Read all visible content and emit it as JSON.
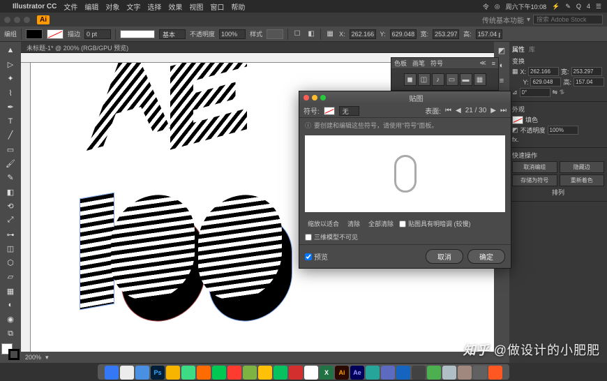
{
  "mac": {
    "apple": "",
    "app": "Illustrator CC",
    "menus": [
      "文件",
      "编辑",
      "对象",
      "文字",
      "选择",
      "效果",
      "视图",
      "窗口",
      "帮助"
    ],
    "right": [
      "令",
      "◎",
      "周六下午10:08",
      "⚡",
      "✎",
      "Q",
      "4",
      "☰"
    ]
  },
  "header": {
    "workspace_label": "传统基本功能",
    "search_placeholder": "搜索 Adobe Stock"
  },
  "options": {
    "stroke_label": "描边",
    "stroke_pt": "0 pt",
    "profile": "基本",
    "opacity_label": "不透明度",
    "opacity_val": "100%",
    "style_label": "样式",
    "x_label": "X:",
    "x_val": "262.166 p",
    "y_label": "Y:",
    "y_val": "629.048",
    "w_label": "宽:",
    "w_val": "253.297",
    "h_label": "高:",
    "h_val": "157.04 px"
  },
  "doc_tab": "未标题-1* @ 200% (RGB/GPU 预览)",
  "status": {
    "zoom": "200%"
  },
  "transform": {
    "tabs": [
      "属性",
      "库"
    ],
    "section": "变换",
    "x": "262.166",
    "y": "253.297",
    "w": "629.048",
    "h": "157.04",
    "angle": "0°"
  },
  "appearance": {
    "section": "外观",
    "fill_label": "填色",
    "opacity_label": "不透明度",
    "opacity_val": "100%",
    "fx": "fx."
  },
  "quick": {
    "section": "快速操作",
    "btns": [
      "取消编组",
      "隐藏边",
      "存储为符号",
      "重新着色"
    ],
    "arrange": "排列"
  },
  "sym_mini": {
    "tabs": [
      "色板",
      "画笔",
      "符号"
    ]
  },
  "dialog": {
    "title": "贴图",
    "symbol_label": "符号:",
    "symbol_val": "无",
    "surface_label": "表面:",
    "surface_val": "21 / 30",
    "hint": "要创建和编辑这些符号，请使用\"符号\"面板。",
    "fit": "缩放以适合",
    "clear": "清除",
    "clear_all": "全部清除",
    "shade": "贴图具有明暗调 (较慢)",
    "invisible": "三维模型不可见",
    "preview": "预览",
    "cancel": "取消",
    "ok": "确定"
  },
  "watermark": {
    "zhihu": "知乎",
    "at": "@做设计的小肥肥"
  },
  "dock_colors": [
    "#3478f6",
    "#ececec",
    "#4a90e2",
    "#001e36",
    "#f7b500",
    "#3ddc84",
    "#ff6b00",
    "#00c853",
    "#ff3b30",
    "#7cb342",
    "#ffc107",
    "#07c160",
    "#d32f2f",
    "#ffffff",
    "#217346",
    "#ff9a00",
    "#9999ff",
    "#26a69a",
    "#5c6bc0",
    "#1565c0",
    "#424242",
    "#4caf50",
    "#b0bec5",
    "#a1887f",
    "#616161",
    "#ff5722"
  ],
  "dock_labels": [
    "",
    "",
    "",
    "Ps",
    "",
    "",
    "",
    "",
    "",
    "",
    "",
    "",
    "",
    "",
    "X",
    "Ai",
    "Ae",
    "",
    "",
    "",
    "",
    "",
    "",
    "",
    "",
    ""
  ]
}
